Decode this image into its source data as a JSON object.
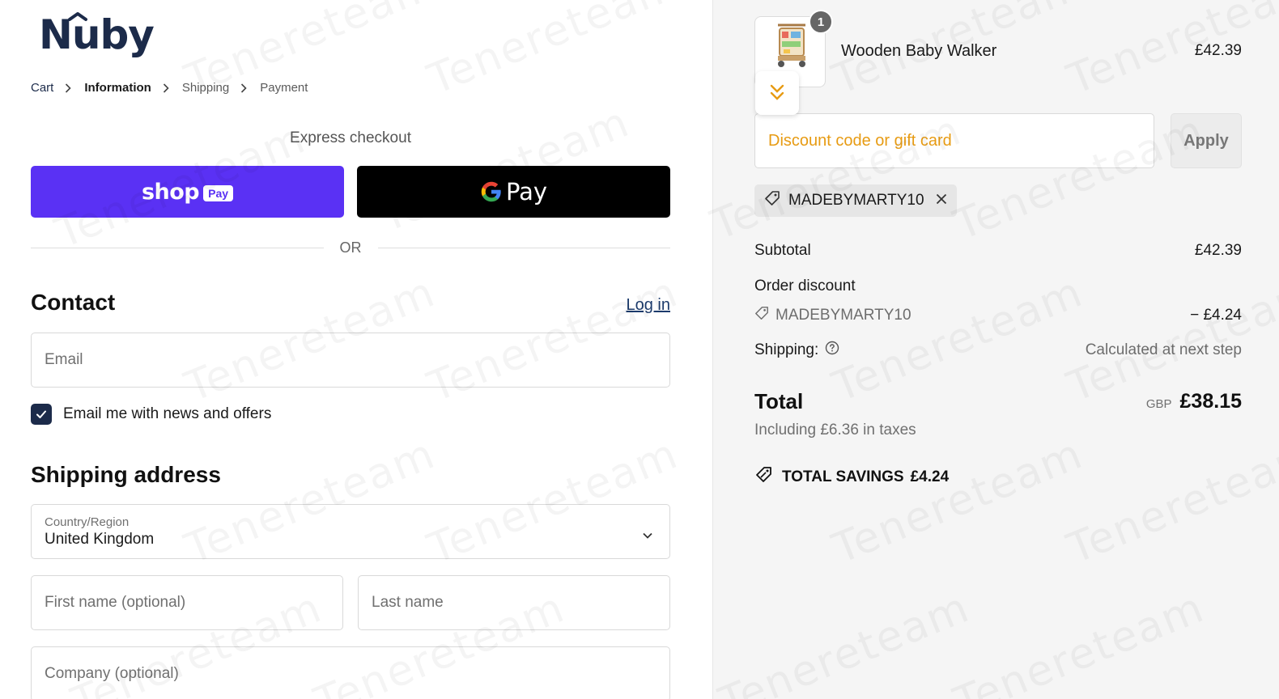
{
  "brand": {
    "name": "Nûby"
  },
  "breadcrumb": [
    {
      "label": "Cart",
      "state": "link"
    },
    {
      "label": "Information",
      "state": "current"
    },
    {
      "label": "Shipping",
      "state": "upcoming"
    },
    {
      "label": "Payment",
      "state": "upcoming"
    }
  ],
  "express": {
    "title": "Express checkout",
    "shop_pay": {
      "word": "shop",
      "pill": "Pay",
      "color": "#5a31f4"
    },
    "gpay": {
      "word": "Pay",
      "color": "#000000"
    },
    "or_label": "OR"
  },
  "contact": {
    "title": "Contact",
    "login_label": "Log in",
    "email_placeholder": "Email",
    "newsletter_label": "Email me with news and offers",
    "newsletter_checked": true
  },
  "shipping": {
    "title": "Shipping address",
    "country_label": "Country/Region",
    "country_value": "United Kingdom",
    "first_name_placeholder": "First name (optional)",
    "last_name_placeholder": "Last name",
    "company_placeholder": "Company (optional)"
  },
  "summary": {
    "item": {
      "quantity": "1",
      "name": "Wooden Baby Walker",
      "price": "£42.39"
    },
    "discount_placeholder": "Discount code or gift card",
    "apply_label": "Apply",
    "applied_code": "MADEBYMARTY10",
    "subtotal_label": "Subtotal",
    "subtotal_value": "£42.39",
    "order_discount_label": "Order discount",
    "order_discount_code": "MADEBYMARTY10",
    "order_discount_value": "− £4.24",
    "shipping_label": "Shipping:",
    "shipping_value": "Calculated at next step",
    "total_label": "Total",
    "currency": "GBP",
    "total_value": "£38.15",
    "taxes_note": "Including £6.36 in taxes",
    "savings_label": "TOTAL SAVINGS",
    "savings_value": "£4.24"
  },
  "watermark": {
    "text": "Tenereteam"
  },
  "colors": {
    "accent": "#1c2b4a",
    "discount_placeholder": "#e79b13",
    "sidebar_bg": "#f5f5f5"
  }
}
